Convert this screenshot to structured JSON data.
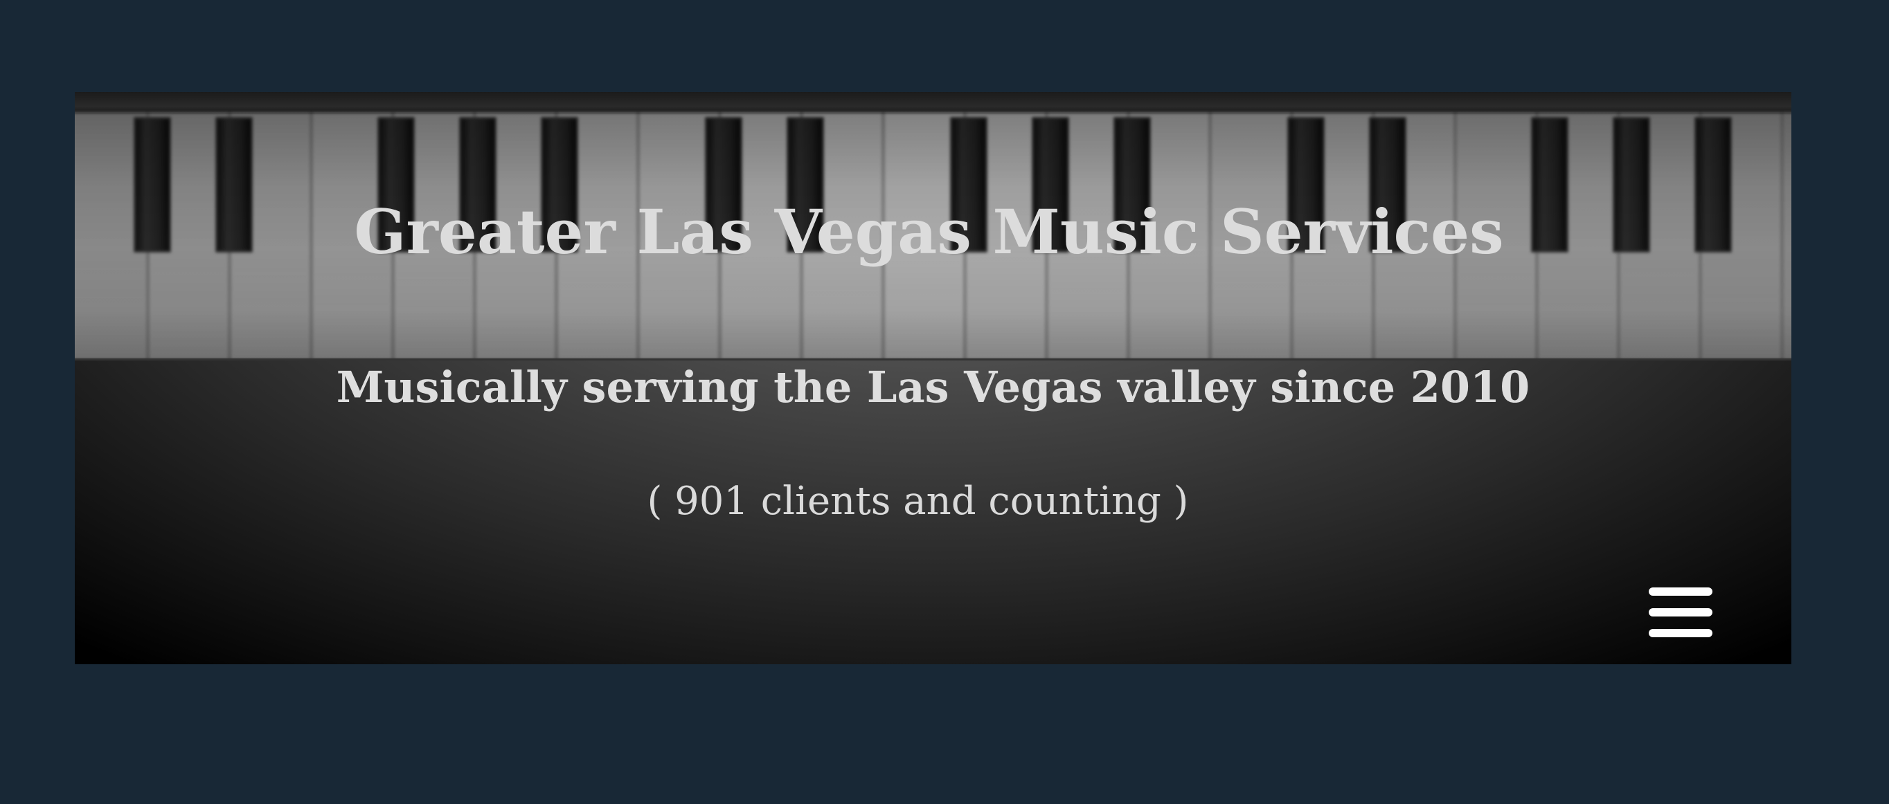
{
  "header": {
    "title": "Greater Las Vegas Music Services",
    "tagline": "Musically serving the Las Vegas valley since 2010",
    "counter": "( 901 clients and counting )"
  },
  "nav": {
    "menu_icon": "hamburger-menu-icon"
  },
  "colors": {
    "page_background": "#182836",
    "text": "#dcdcdc",
    "menu_icon": "#ffffff"
  }
}
